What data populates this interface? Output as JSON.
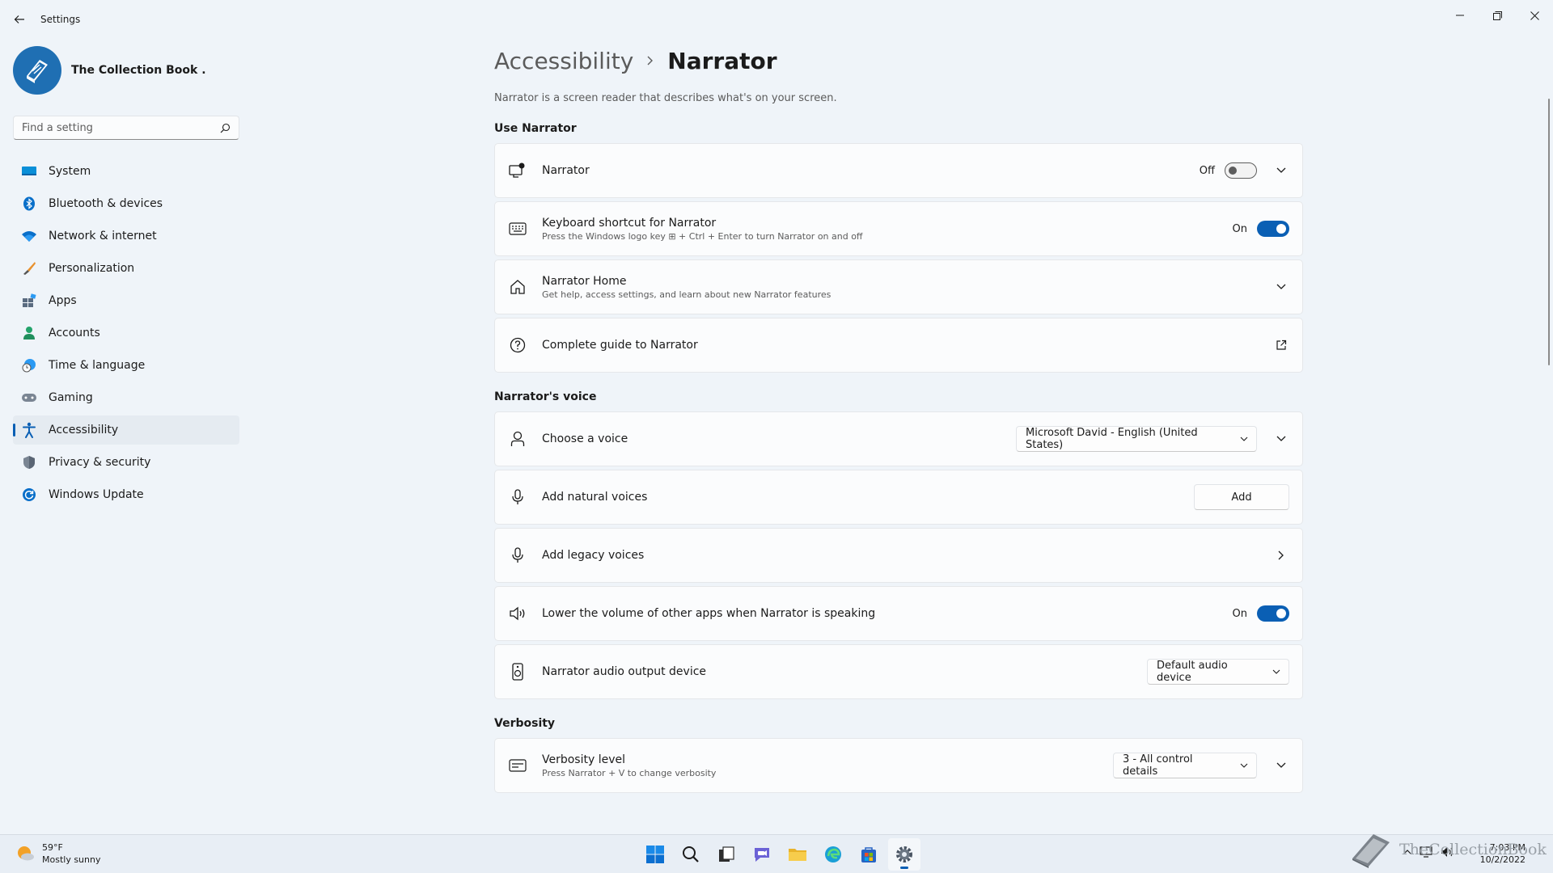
{
  "window": {
    "title": "Settings"
  },
  "profile": {
    "name": "The Collection Book ."
  },
  "search": {
    "placeholder": "Find a setting"
  },
  "nav": [
    {
      "label": "System",
      "icon": "system-icon"
    },
    {
      "label": "Bluetooth & devices",
      "icon": "bluetooth-icon"
    },
    {
      "label": "Network & internet",
      "icon": "wifi-icon"
    },
    {
      "label": "Personalization",
      "icon": "brush-icon"
    },
    {
      "label": "Apps",
      "icon": "apps-icon"
    },
    {
      "label": "Accounts",
      "icon": "accounts-icon"
    },
    {
      "label": "Time & language",
      "icon": "clock-globe-icon"
    },
    {
      "label": "Gaming",
      "icon": "gamepad-icon"
    },
    {
      "label": "Accessibility",
      "icon": "accessibility-icon",
      "active": true
    },
    {
      "label": "Privacy & security",
      "icon": "shield-icon"
    },
    {
      "label": "Windows Update",
      "icon": "update-icon"
    }
  ],
  "breadcrumb": {
    "parent": "Accessibility",
    "current": "Narrator"
  },
  "description": "Narrator is a screen reader that describes what's on your screen.",
  "sections": {
    "use": {
      "title": "Use Narrator",
      "narrator": {
        "title": "Narrator",
        "state": "Off"
      },
      "shortcut": {
        "title": "Keyboard shortcut for Narrator",
        "sub": "Press the Windows logo key ⊞ + Ctrl + Enter to turn Narrator on and off",
        "state": "On"
      },
      "home": {
        "title": "Narrator Home",
        "sub": "Get help, access settings, and learn about new Narrator features"
      },
      "guide": {
        "title": "Complete guide to Narrator"
      }
    },
    "voice": {
      "title": "Narrator's voice",
      "choose": {
        "title": "Choose a voice",
        "value": "Microsoft David - English (United States)"
      },
      "natural": {
        "title": "Add natural voices",
        "button": "Add"
      },
      "legacy": {
        "title": "Add legacy voices"
      },
      "lower": {
        "title": "Lower the volume of other apps when Narrator is speaking",
        "state": "On"
      },
      "output": {
        "title": "Narrator audio output device",
        "value": "Default audio device"
      }
    },
    "verbosity": {
      "title": "Verbosity",
      "level": {
        "title": "Verbosity level",
        "sub": "Press Narrator + V to change verbosity",
        "value": "3 - All control details"
      }
    }
  },
  "taskbar": {
    "weather": {
      "temp": "59°F",
      "condition": "Mostly sunny"
    },
    "clock": {
      "time": "7:03 PM",
      "date": "10/2/2022"
    },
    "watermark": "TheCollectionBook"
  },
  "colors": {
    "accent": "#0a5fb4",
    "background": "#eff4f9",
    "card": "#fbfcfd"
  }
}
